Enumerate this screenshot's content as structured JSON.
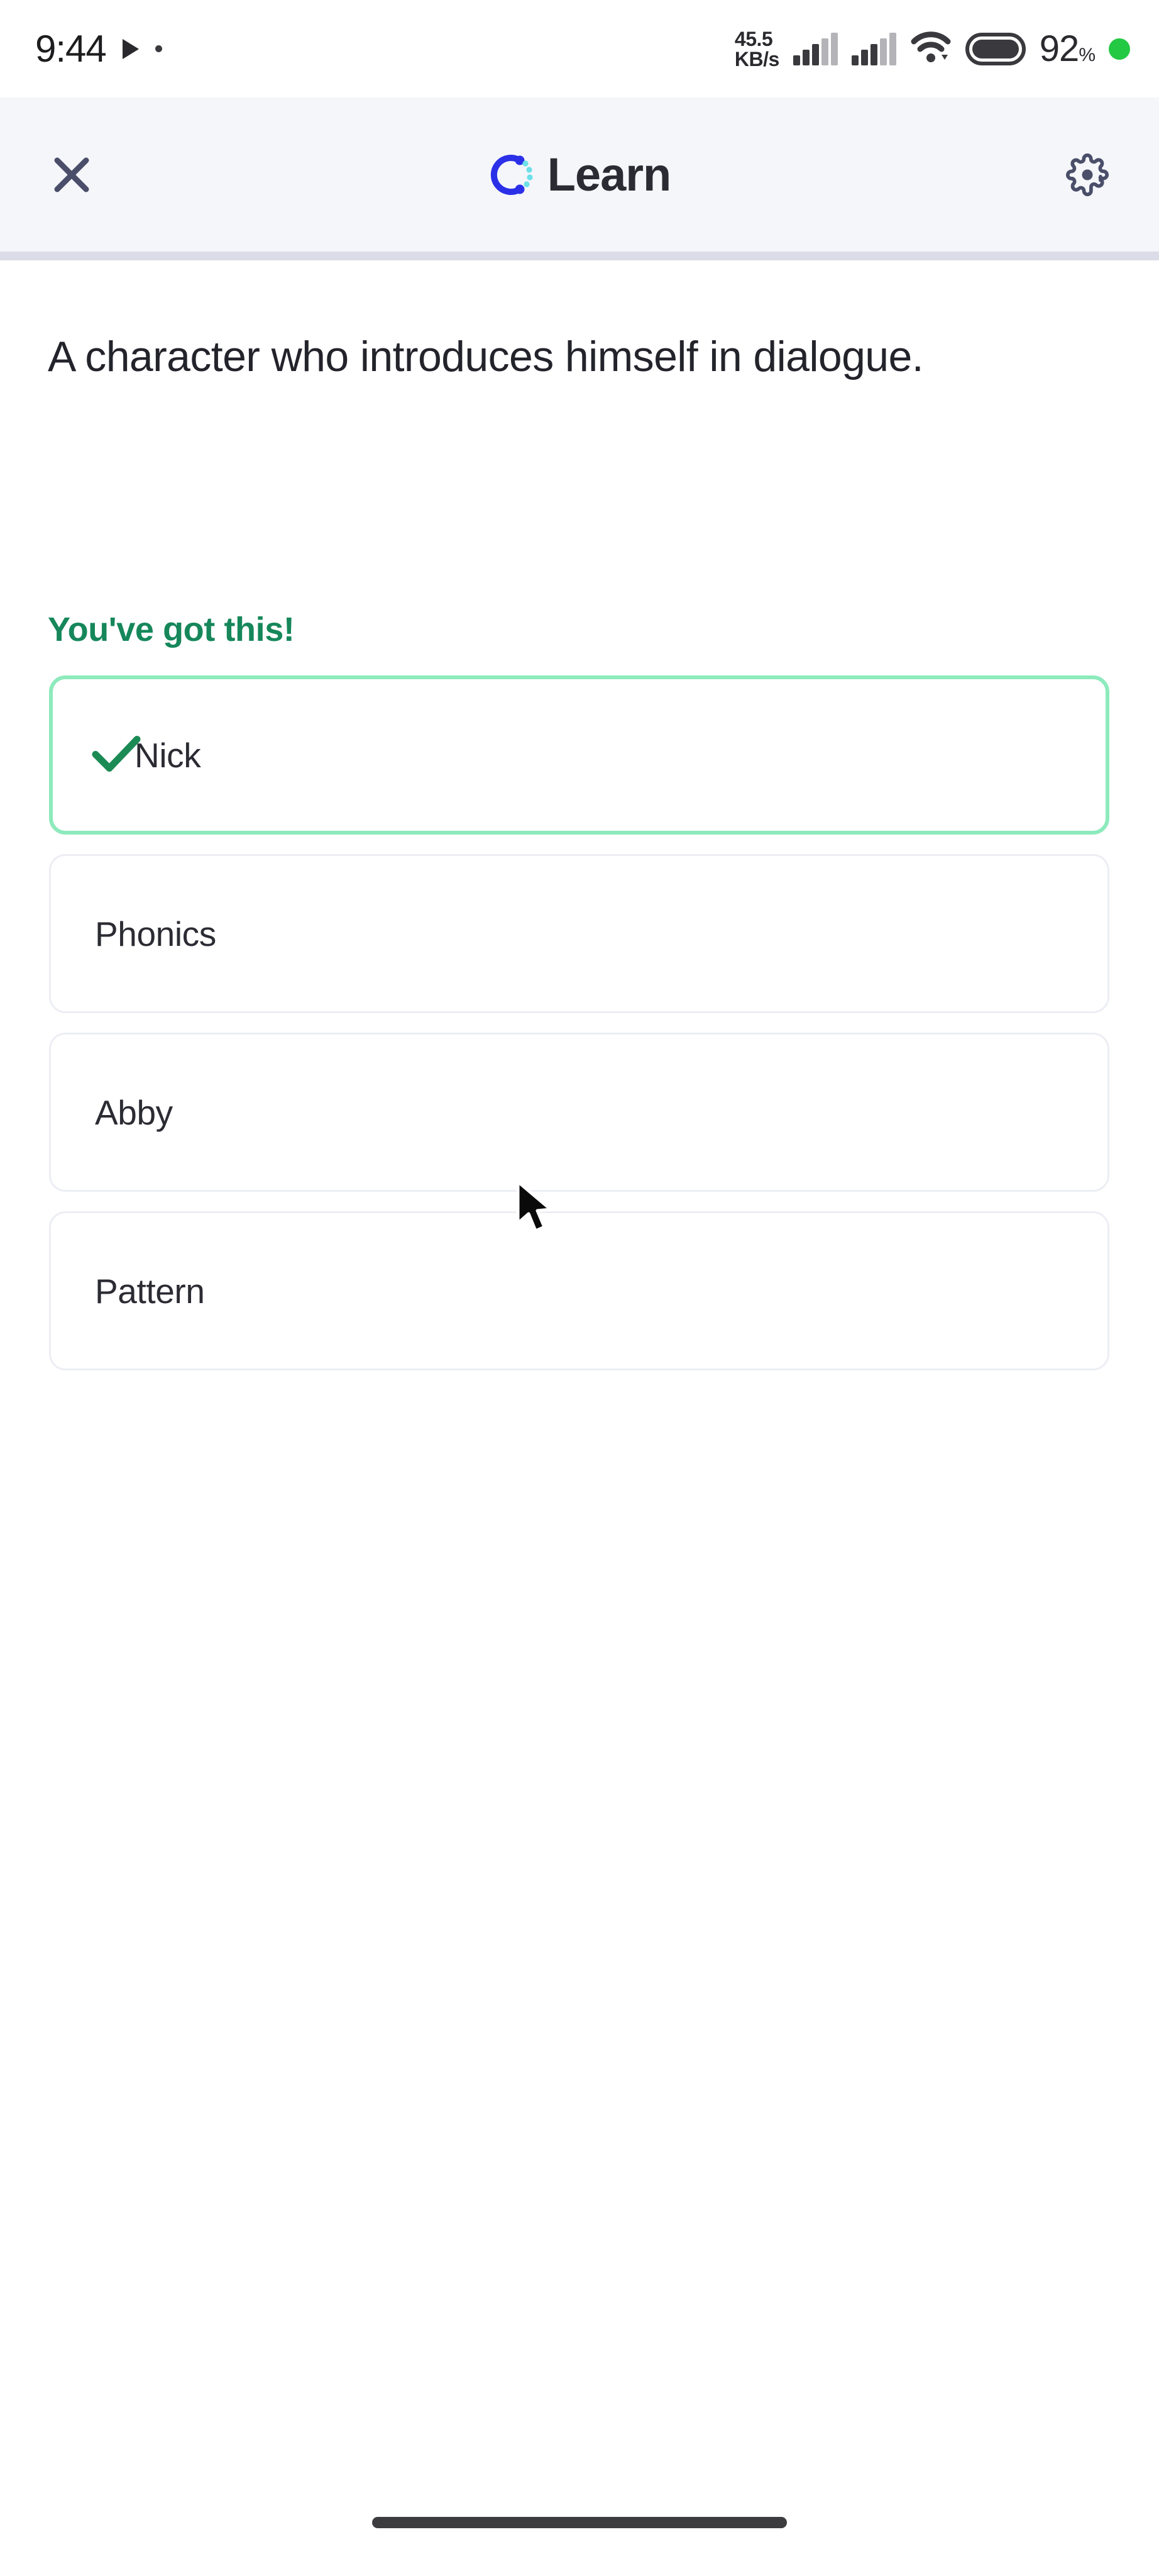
{
  "status_bar": {
    "time": "9:44",
    "play_icon": "play-triangle-icon",
    "dot_icon": "small-dot-icon",
    "net_speed_value": "45.5",
    "net_speed_unit": "KB/s",
    "signal_icon_1": "cellular-signal-icon",
    "signal_icon_2": "cellular-signal-icon",
    "wifi_icon": "wifi-icon",
    "battery_icon": "battery-icon",
    "battery_percent": "92",
    "percent_symbol": "%",
    "status_dot_icon": "green-status-dot-icon",
    "status_dot_color": "#24c943"
  },
  "header": {
    "close_icon": "close-x-icon",
    "logo_icon": "learn-circle-logo-icon",
    "title": "Learn",
    "settings_icon": "gear-icon",
    "background_color": "#f5f6fa",
    "progress_bar_color": "#dcdce8"
  },
  "main": {
    "question": "A character who introduces himself in dialogue.",
    "feedback": "You've got this!",
    "feedback_color": "#16875a",
    "correct_border_color": "#8deabc",
    "option_border_color": "#eceef4",
    "check_icon": "checkmark-icon",
    "check_color": "#1b8a54",
    "options": [
      {
        "label": "Nick",
        "state": "correct"
      },
      {
        "label": "Phonics",
        "state": "default"
      },
      {
        "label": "Abby",
        "state": "default"
      },
      {
        "label": "Pattern",
        "state": "default"
      }
    ]
  },
  "nav_bar": {
    "home_indicator_icon": "home-indicator-bar",
    "home_indicator_color": "#3c3c3f"
  },
  "cursor": {
    "icon": "mouse-pointer-arrow-icon"
  }
}
